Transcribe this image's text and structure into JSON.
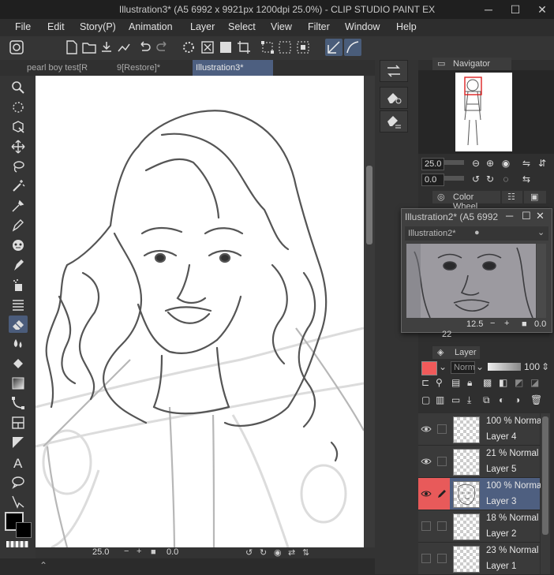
{
  "window": {
    "title": "Illustration3* (A5 6992 x 9921px 1200dpi 25.0%) - CLIP STUDIO PAINT EX",
    "minimize": "─",
    "maximize": "☐",
    "close": "✕"
  },
  "menu": [
    "File",
    "Edit",
    "Story(P)",
    "Animation",
    "Layer",
    "Select",
    "View",
    "Filter",
    "Window",
    "Help"
  ],
  "tabs": [
    {
      "label": "pearl boy test[R"
    },
    {
      "label": "9[Restore]*"
    },
    {
      "label": "Illustration3*"
    }
  ],
  "canvas_status": {
    "zoom": "25.0",
    "angle": "0.0"
  },
  "navigator": {
    "title": "Navigator",
    "zoom": "25.0",
    "angle": "0.0"
  },
  "color_wheel": {
    "title": "Color Wheel"
  },
  "float_window": {
    "title": "Illustration2* (A5 6992",
    "tab": "Illustration2*",
    "zoom": "12.5",
    "angle": "0.0",
    "behind_value": "22"
  },
  "layer_panel": {
    "title": "Layer",
    "blend_mode": "Norm",
    "opacity": "100",
    "color": "#f05a5a",
    "layers": [
      {
        "mode": "100 % Normal",
        "name": "Layer 4",
        "visible": true,
        "selected": false
      },
      {
        "mode": "21 % Normal",
        "name": "Layer 5",
        "visible": true,
        "selected": false
      },
      {
        "mode": "100 % Normal",
        "name": "Layer 3",
        "visible": true,
        "selected": true
      },
      {
        "mode": "18 % Normal",
        "name": "Layer 2",
        "visible": false,
        "selected": false
      },
      {
        "mode": "23 % Normal",
        "name": "Layer 1",
        "visible": false,
        "selected": false
      }
    ]
  },
  "colors": {
    "accent": "#4d5f80",
    "selected_layer_marker": "#e85a5a",
    "main_color": "#000000",
    "sub_color": "#000000"
  },
  "tools": [
    "zoom-icon",
    "operation-icon",
    "move-layer-icon",
    "move-icon",
    "lasso-icon",
    "magic-wand-icon",
    "eyedropper-icon",
    "pen-icon",
    "brush-icon",
    "airbrush-icon",
    "decoration-icon",
    "hatching-icon",
    "eraser-icon",
    "blend-icon",
    "fill-icon",
    "gradient-icon",
    "figure-icon",
    "frame-icon",
    "ruler-icon",
    "text-icon",
    "balloon-icon",
    "correct-line-icon"
  ]
}
